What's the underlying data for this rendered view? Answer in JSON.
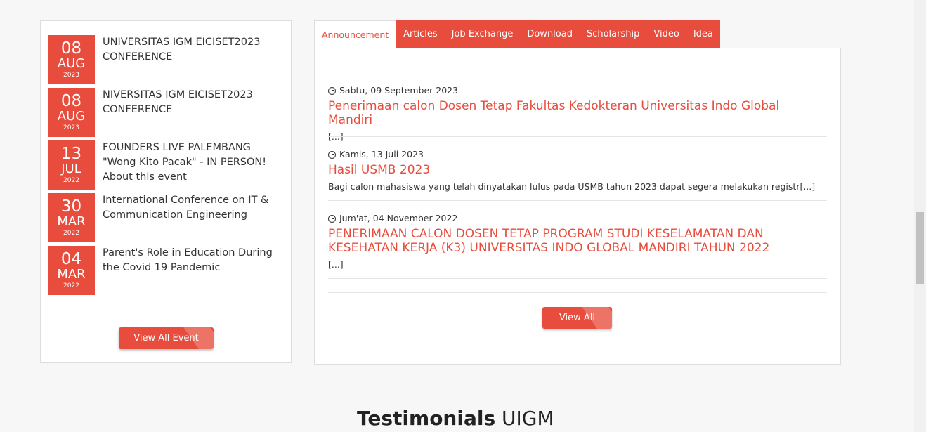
{
  "events": {
    "items": [
      {
        "day": "08",
        "month": "AUG",
        "year": "2023",
        "title": "UNIVERSITAS IGM EICISET2023 CONFERENCE"
      },
      {
        "day": "08",
        "month": "AUG",
        "year": "2023",
        "title": "NIVERSITAS IGM EICISET2023 CONFERENCE"
      },
      {
        "day": "13",
        "month": "JUL",
        "year": "2022",
        "title": "FOUNDERS LIVE PALEMBANG \"Wong Kito Pacak\" - IN PERSON! About this event"
      },
      {
        "day": "30",
        "month": "MAR",
        "year": "2022",
        "title": "International Conference on IT & Communication Engineering"
      },
      {
        "day": "04",
        "month": "MAR",
        "year": "2022",
        "title": "Parent's Role in Education During the Covid 19 Pandemic"
      }
    ],
    "view_all_label": "View All Event"
  },
  "tabs": [
    {
      "label": "Announcement",
      "active": true
    },
    {
      "label": "Articles"
    },
    {
      "label": "Job Exchange"
    },
    {
      "label": "Download"
    },
    {
      "label": "Scholarship"
    },
    {
      "label": "Video"
    },
    {
      "label": "Idea"
    }
  ],
  "announcements": [
    {
      "date": "Sabtu, 09 September 2023",
      "title": "Penerimaan calon Dosen Tetap Fakultas Kedokteran Universitas Indo Global Mandiri",
      "excerpt": "[...]"
    },
    {
      "date": "Kamis, 13 Juli 2023",
      "title": "Hasil USMB 2023",
      "excerpt": "Bagi calon mahasiswa yang telah dinyatakan lulus pada USMB tahun 2023 dapat segera melakukan registr[...]"
    },
    {
      "date": "Jum'at, 04 November 2022",
      "title": "PENERIMAAN CALON DOSEN TETAP PROGRAM STUDI KESELAMATAN DAN KESEHATAN KERJA (K3) UNIVERSITAS INDO GLOBAL MANDIRI TAHUN 2022",
      "excerpt": "[...]"
    }
  ],
  "announcements_view_all_label": "View All",
  "testimonials": {
    "title_bold": "Testimonials",
    "title_light": "UIGM"
  },
  "colors": {
    "accent": "#e74c3c",
    "background": "#f7f7f7"
  }
}
